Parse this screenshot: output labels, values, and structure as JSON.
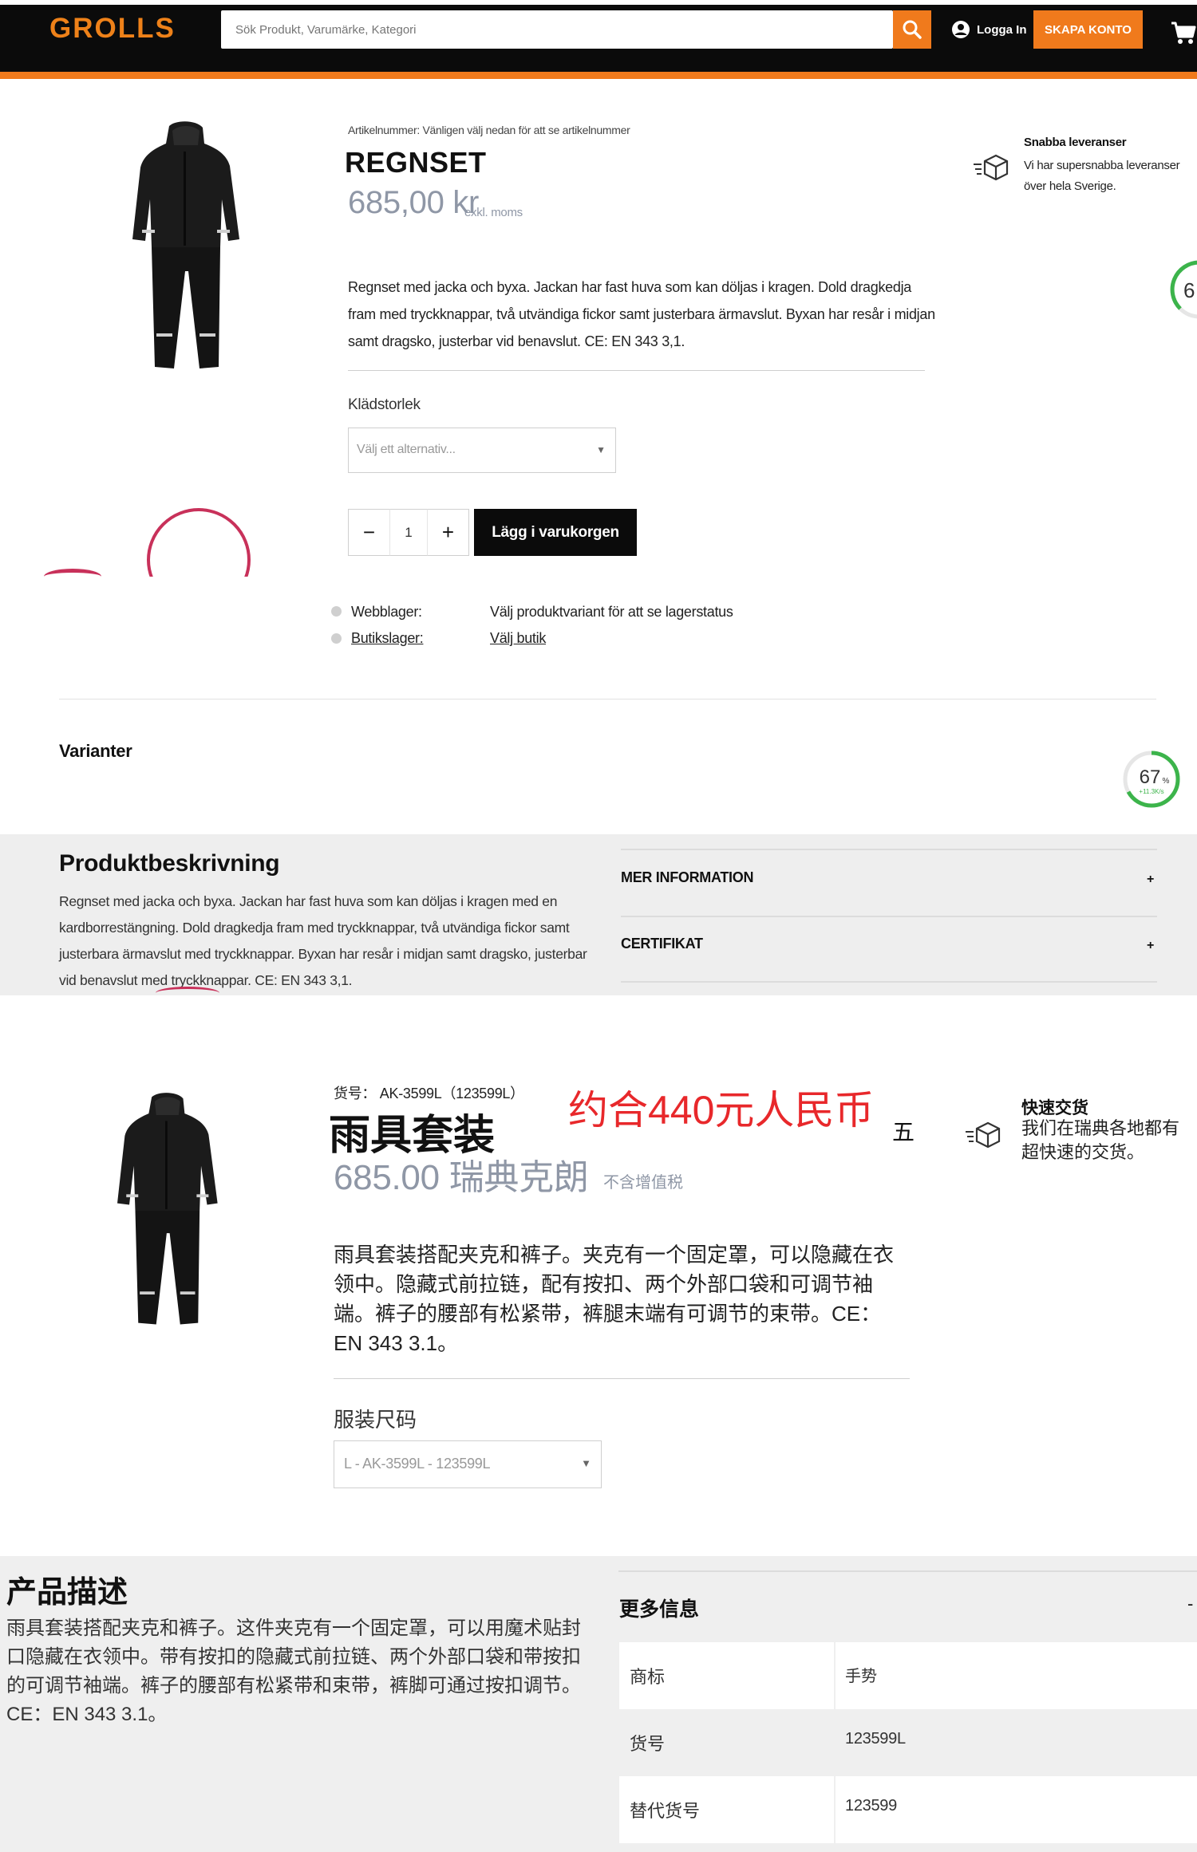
{
  "header": {
    "logo": "GROLLS",
    "search_placeholder": "Sök Produkt, Varumärke, Kategori",
    "login_label": "Logga In",
    "create_account_label": "SKAPA KONTO",
    "accent_color": "#f07a1c"
  },
  "product_sv": {
    "sku_label": "Artikelnummer: Vänligen välj nedan för att se artikelnummer",
    "title": "REGNSET",
    "price": "685,00 kr",
    "price_note": "exkl. moms",
    "delivery_title": "Snabba leveranser",
    "delivery_text": "Vi har supersnabba leveranser över hela Sverige.",
    "description": "Regnset med jacka och byxa. Jackan har fast huva som kan döljas i kragen. Dold dragkedja fram med tryckknappar, två utvändiga fickor samt justerbara ärmavslut. Byxan har resår i midjan samt dragsko, justerbar vid benavslut. CE: EN 343 3,1.",
    "size_label": "Klädstorlek",
    "size_placeholder": "Välj ett alternativ...",
    "quantity": "1",
    "add_to_cart_label": "Lägg i varukorgen",
    "stock": {
      "web_label": "Webblager:",
      "web_value": "Välj produktvariant för att se lagerstatus",
      "store_label": "Butikslager:",
      "store_value": "Välj butik"
    },
    "variants_title": "Varianter",
    "gauge_partial": "6",
    "gauge": {
      "percent": "67",
      "unit": "%",
      "rate": "+11.3K/s",
      "value": 0.67
    }
  },
  "description_sv": {
    "title": "Produktbeskrivning",
    "text": "Regnset med jacka och byxa. Jackan har fast huva som kan döljas i kragen med en kardborrestängning. Dold dragkedja fram med tryckknappar, två utvändiga fickor samt justerbara ärmavslut med tryckknappar. Byxan har resår i midjan samt dragsko, justerbar vid benavslut med tryckknappar. CE: EN 343 3,1.",
    "accordion": [
      {
        "label": "MER INFORMATION",
        "icon": "+"
      },
      {
        "label": "CERTIFIKAT",
        "icon": "+"
      }
    ]
  },
  "product_zh": {
    "sku": "货号： AK-3599L（123599L）",
    "title": "雨具套装",
    "rmb_note": "约合440元人民币",
    "five_char": "五",
    "price": "685.00 瑞典克朗",
    "price_note": "不含增值税",
    "delivery_title": "快速交货",
    "delivery_text": "我们在瑞典各地都有超快速的交货。",
    "description": "雨具套装搭配夹克和裤子。夹克有一个固定罩，可以隐藏在衣领中。隐藏式前拉链，配有按扣、两个外部口袋和可调节袖端。裤子的腰部有松紧带，裤腿末端有可调节的束带。CE：EN 343 3.1。",
    "size_label": "服装尺码",
    "size_value": "L - AK-3599L - 123599L"
  },
  "description_zh": {
    "title": "产品描述",
    "text": "雨具套装搭配夹克和裤子。这件夹克有一个固定罩，可以用魔术贴封口隐藏在衣领中。带有按扣的隐藏式前拉链、两个外部口袋和带按扣的可调节袖端。裤子的腰部有松紧带和束带，裤脚可通过按扣调节。CE：EN 343 3.1。",
    "info_title": "更多信息",
    "info_toggle": "-",
    "rows": [
      {
        "key": "商标",
        "value": "手势"
      },
      {
        "key": "货号",
        "value": "123599L"
      },
      {
        "key": "替代货号",
        "value": "123599"
      }
    ]
  }
}
